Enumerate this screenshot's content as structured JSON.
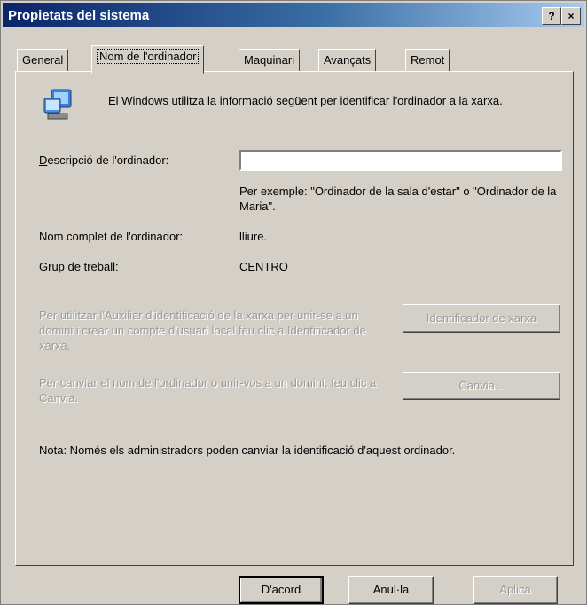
{
  "window": {
    "title": "Propietats del sistema",
    "help_button": "?",
    "close_button": "×"
  },
  "tabs": [
    {
      "label": "General"
    },
    {
      "label": "Nom de l'ordinador"
    },
    {
      "label": "Maquinari"
    },
    {
      "label": "Avançats"
    },
    {
      "label": "Remot"
    }
  ],
  "panel": {
    "intro": "El Windows utilitza la informació següent per identificar l'ordinador a la xarxa.",
    "description_label": "Descripció de l'ordinador:",
    "description_value": "",
    "example": "Per exemple: \"Ordinador de la sala d'estar\" o \"Ordinador de la Maria\".",
    "full_name_label": "Nom complet de l'ordinador:",
    "full_name_value": "lliure.",
    "workgroup_label": "Grup de treball:",
    "workgroup_value": "CENTRO",
    "network_id_text": "Per utilitzar l'Auxiliar d'identificació de la xarxa per unir-se a un domini i crear un compte d'usuari local feu clic a Identificador de xarxa.",
    "network_id_button": "Identificador de xarxa",
    "change_text": "Per canviar el nom de l'ordinador o unir-vos a un domini, feu clic a Canvia.",
    "change_button": "Canvia...",
    "note": "Nota: Només els administradors poden canviar la identificació d'aquest ordinador."
  },
  "footer": {
    "ok": "D'acord",
    "cancel": "Anul·la",
    "apply": "Aplica"
  }
}
